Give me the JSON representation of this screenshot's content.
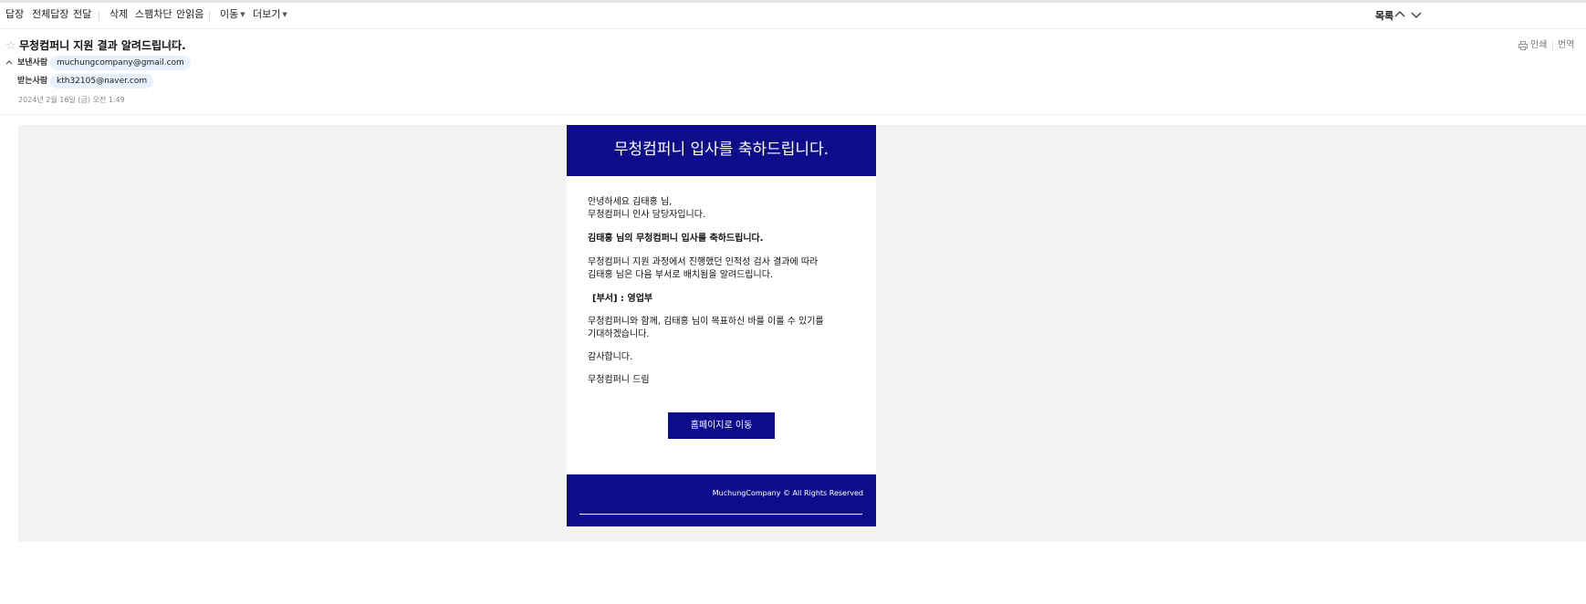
{
  "toolbar": {
    "items": [
      "답장",
      "전체답장",
      "전달",
      "삭제",
      "스팸차단",
      "안읽음",
      "이동",
      "더보기"
    ],
    "right_label": "목록"
  },
  "header": {
    "subject": "무청컴퍼니 지원 결과 알려드립니다.",
    "print_label": "인쇄",
    "translate_label": "번역",
    "sender_label": "보낸사람",
    "sender_email": "muchungcompany@gmail.com",
    "recipient_label": "받는사람",
    "recipient_email": "kth32105@naver.com",
    "date": "2024년 2월 16일 (금) 오전 1:49"
  },
  "email": {
    "banner_title": "무청컴퍼니 입사를 축하드립니다.",
    "greeting_line1": "안녕하세요 김태홍 님,",
    "greeting_line2": "무청컴퍼니 인사 담당자입니다.",
    "congrats": "김태홍 님의 무청컴퍼니 입사를 축하드립니다.",
    "result_line1": "무청컴퍼니 지원 과정에서 진행했던 인적성 검사 결과에 따라",
    "result_line2": "김태홍 님은 다음 부서로 배치됨을 알려드립니다.",
    "department": "[부서] : 영업부",
    "closing_line1": "무청컴퍼니와 함께, 김태홍 님이 목표하신 바를 이룰 수 있기를",
    "closing_line2": "기대하겠습니다.",
    "thanks": "감사합니다.",
    "signature": "무청컴퍼니 드림",
    "button_label": "홈페이지로 이동",
    "footer_text": "MuchungCompany ©  All Rights Reserved"
  },
  "colors": {
    "brand_navy": "#0d0d8c",
    "chip_bg": "#e7f0fc",
    "page_bg": "#f2f2f2"
  },
  "icons": [
    "star-icon",
    "external-link-icon",
    "print-icon",
    "chevron-up-icon",
    "chevron-down-icon",
    "caret-down-icon",
    "collapse-icon"
  ]
}
